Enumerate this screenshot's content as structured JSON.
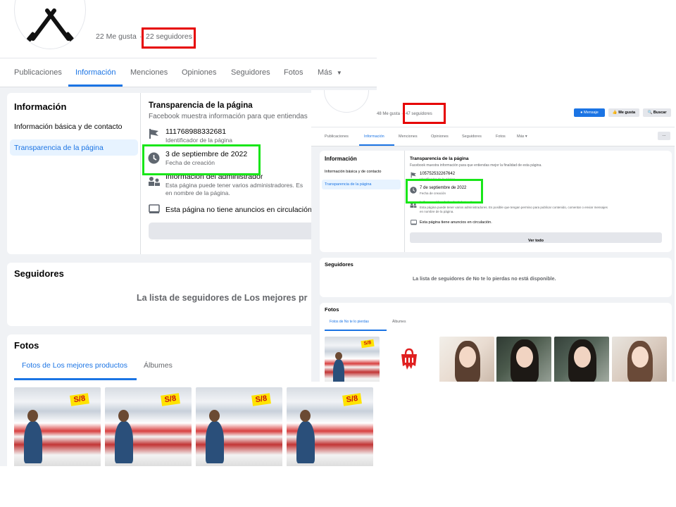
{
  "pageA": {
    "likes": "22 Me gusta",
    "dot": "·",
    "followers": "22 seguidores",
    "tabs": [
      "Publicaciones",
      "Información",
      "Menciones",
      "Opiniones",
      "Seguidores",
      "Fotos",
      "Más"
    ],
    "info": {
      "heading": "Información",
      "nav": [
        "Información básica y de contacto",
        "Transparencia de la página"
      ],
      "transparency_title": "Transparencia de la página",
      "transparency_sub": "Facebook muestra información para que entiendas",
      "page_id": "111768988332681",
      "page_id_label": "Identificador de la página",
      "created_date": "3 de septiembre de 2022",
      "created_label": "Fecha de creación",
      "admin_title": "Información del administrador",
      "admin_desc_1": "Esta página puede tener varios administradores. Es",
      "admin_desc_2": "en nombre de la página.",
      "ads": "Esta página no tiene anuncios en circulación e"
    },
    "followers_card": {
      "heading": "Seguidores",
      "message": "La lista de seguidores de Los mejores pr"
    },
    "photos_card": {
      "heading": "Fotos",
      "tabs": [
        "Fotos de Los mejores productos",
        "Álbumes"
      ],
      "sign_text": "S/8"
    }
  },
  "pageB": {
    "likes": "48 Me gusta",
    "dot": "·",
    "followers": "47 seguidores",
    "buttons": {
      "message": "Mensaje",
      "like": "Me gusta",
      "search": "Buscar"
    },
    "tabs": [
      "Publicaciones",
      "Información",
      "Menciones",
      "Opiniones",
      "Seguidores",
      "Fotos",
      "Más"
    ],
    "more_label": "···",
    "info": {
      "heading": "Información",
      "nav": [
        "Información básica y de contacto",
        "Transparencia de la página"
      ],
      "transparency_title": "Transparencia de la página",
      "transparency_sub": "Facebook muestra información para que entiendas mejor la finalidad de esta página.",
      "page_id": "105752532267642",
      "page_id_label": "Identificador de la página",
      "created_date": "7 de septiembre de 2022",
      "created_label": "Fecha de creación",
      "admin_title": "Información del administrador",
      "admin_desc_1": "Esta página puede tener varios administradores. Es posible que tengan permiso para publicar contenido, comentar o enviar mensajes",
      "admin_desc_2": "en nombre de la página.",
      "ads": "Esta página tiene anuncios en circulación.",
      "see_all": "Ver todo"
    },
    "followers_card": {
      "heading": "Seguidores",
      "message": "La lista de seguidores de No te lo pierdas no está disponible."
    },
    "photos_card": {
      "heading": "Fotos",
      "tabs": [
        "Fotos de No te lo pierdas",
        "Álbumes"
      ],
      "sign_text": "S/8"
    }
  },
  "colors": {
    "accent": "#1b74e4",
    "highlight_red": "#e60000",
    "highlight_green": "#19e619",
    "background": "#f0f2f5"
  }
}
